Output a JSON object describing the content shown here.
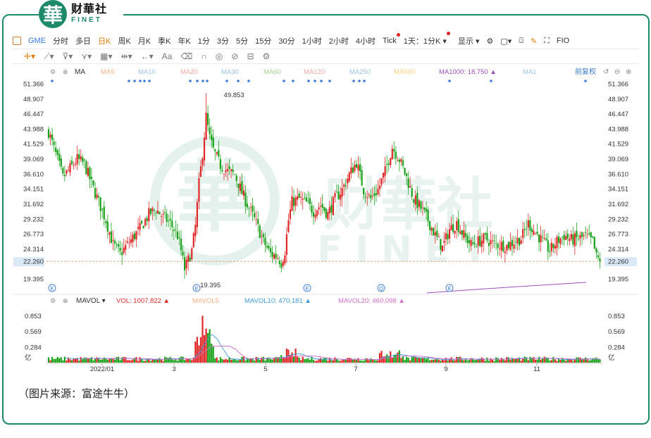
{
  "logo": {
    "seal_char": "華",
    "name_cn": "财華社",
    "name_en": "FINET"
  },
  "toolbar": {
    "ticker": "GME",
    "periods": [
      "分时",
      "多日",
      "日K",
      "周K",
      "月K",
      "季K",
      "年K",
      "1分",
      "3分",
      "5分",
      "15分",
      "30分",
      "1小时",
      "2小时",
      "4小时",
      "Tick",
      "1天：1分K"
    ],
    "active_period": "日K",
    "display_label": "显示",
    "fio_label": "FIO",
    "aa_label": "Aa"
  },
  "indicators": {
    "ma_label": "MA",
    "ma_items": [
      "MA5",
      "MA10",
      "MA20",
      "MA30",
      "MA60",
      "MA120",
      "MA250",
      "MA500",
      "MA1000: 18.750",
      "MA1"
    ],
    "adjust_label": "前复权",
    "vol_label": "MAVOL",
    "vol_items": [
      "VOL: 1007.822",
      "MAVOL5",
      "MAVOL10: 470.181",
      "MAVOL20: 460.098"
    ]
  },
  "price_axis": {
    "ticks": [
      "51.366",
      "48.907",
      "46.447",
      "43.988",
      "41.529",
      "39.069",
      "36.610",
      "34.151",
      "31.692",
      "29.232",
      "26.773",
      "24.314",
      "22.260",
      "19.395"
    ],
    "current": "22.260"
  },
  "vol_axis": {
    "ticks": [
      "0.853",
      "0.569",
      "0.284",
      "亿"
    ]
  },
  "time_axis": {
    "labels": [
      "2022/01",
      "3",
      "5",
      "7",
      "9",
      "11"
    ]
  },
  "annotations": {
    "high": "49.853",
    "low": "19.395"
  },
  "event_markers": [
    "E",
    "E",
    "E",
    "Q",
    "E"
  ],
  "caption": "（图片来源：富途牛牛）",
  "colors": {
    "up": "#e02828",
    "down": "#1aa31a",
    "brand": "#1d8a6a",
    "accent": "#e07a00"
  },
  "chart_data": {
    "type": "candlestick",
    "x": [
      "2022-01",
      "2022-03",
      "2022-05",
      "2022-07",
      "2022-09",
      "2022-11"
    ],
    "ylim": [
      19.395,
      51.366
    ],
    "close_trend": [
      [
        0,
        43.5
      ],
      [
        4,
        39.8
      ],
      [
        8,
        36.0
      ],
      [
        12,
        37.5
      ],
      [
        16,
        39.0
      ],
      [
        20,
        38.2
      ],
      [
        24,
        35.0
      ],
      [
        28,
        32.0
      ],
      [
        32,
        29.0
      ],
      [
        36,
        25.0
      ],
      [
        40,
        23.5
      ],
      [
        44,
        25.0
      ],
      [
        48,
        26.5
      ],
      [
        52,
        28.0
      ],
      [
        56,
        30.0
      ],
      [
        60,
        30.8
      ],
      [
        64,
        29.5
      ],
      [
        68,
        28.5
      ],
      [
        72,
        26.5
      ],
      [
        74,
        24.0
      ],
      [
        76,
        21.0
      ],
      [
        78,
        22.5
      ],
      [
        80,
        24.0
      ],
      [
        82,
        28.0
      ],
      [
        84,
        35.0
      ],
      [
        86,
        40.0
      ],
      [
        88,
        46.0
      ],
      [
        90,
        42.5
      ],
      [
        92,
        40.5
      ],
      [
        96,
        38.0
      ],
      [
        100,
        37.0
      ],
      [
        104,
        36.5
      ],
      [
        108,
        33.5
      ],
      [
        112,
        31.0
      ],
      [
        116,
        28.5
      ],
      [
        120,
        25.5
      ],
      [
        124,
        23.5
      ],
      [
        128,
        23.0
      ],
      [
        130,
        22.0
      ],
      [
        132,
        24.0
      ],
      [
        134,
        29.0
      ],
      [
        136,
        32.0
      ],
      [
        140,
        32.5
      ],
      [
        144,
        31.8
      ],
      [
        148,
        30.5
      ],
      [
        152,
        31.5
      ],
      [
        156,
        30.0
      ],
      [
        160,
        32.5
      ],
      [
        164,
        34.0
      ],
      [
        168,
        36.5
      ],
      [
        172,
        38.5
      ],
      [
        176,
        34.0
      ],
      [
        180,
        32.5
      ],
      [
        184,
        34.0
      ],
      [
        188,
        37.0
      ],
      [
        192,
        41.0
      ],
      [
        196,
        39.0
      ],
      [
        200,
        36.0
      ],
      [
        204,
        32.5
      ],
      [
        208,
        31.0
      ],
      [
        212,
        29.0
      ],
      [
        216,
        26.5
      ],
      [
        220,
        24.5
      ],
      [
        224,
        27.5
      ],
      [
        228,
        28.5
      ],
      [
        232,
        26.5
      ],
      [
        236,
        25.0
      ],
      [
        240,
        25.5
      ],
      [
        244,
        26.0
      ],
      [
        248,
        25.2
      ],
      [
        252,
        25.0
      ],
      [
        256,
        24.8
      ],
      [
        260,
        25.5
      ],
      [
        264,
        26.0
      ],
      [
        268,
        28.5
      ],
      [
        272,
        27.0
      ],
      [
        276,
        25.5
      ],
      [
        280,
        24.0
      ],
      [
        284,
        25.5
      ],
      [
        288,
        26.5
      ],
      [
        292,
        25.8
      ],
      [
        296,
        26.0
      ],
      [
        300,
        26.3
      ],
      [
        304,
        25.5
      ],
      [
        306,
        23.0
      ],
      [
        308,
        22.26
      ]
    ],
    "vol_peak": 1.0078,
    "mavol10": 470.181,
    "mavol20": 460.098,
    "ma1000": 18.75,
    "high": 49.853,
    "low": 19.395,
    "last": 22.26
  }
}
